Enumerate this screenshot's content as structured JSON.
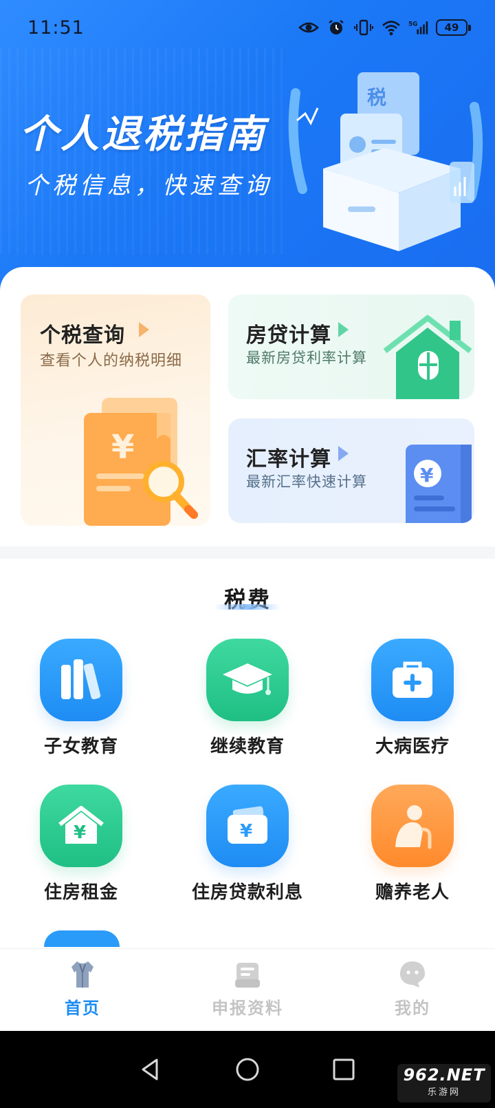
{
  "status_bar": {
    "time": "11:51",
    "battery": "49",
    "network": "5G"
  },
  "banner": {
    "title": "个人退税指南",
    "subtitle": "个税信息，快速查询",
    "illustration_label": "税"
  },
  "features": {
    "tax_query": {
      "title": "个税查询",
      "subtitle": "查看个人的纳税明细",
      "symbol": "¥"
    },
    "mortgage": {
      "title": "房贷计算",
      "subtitle": "最新房贷利率计算"
    },
    "exchange": {
      "title": "汇率计算",
      "subtitle": "最新汇率快速计算",
      "symbol": "¥"
    }
  },
  "section": {
    "title": "税费"
  },
  "categories": [
    {
      "label": "子女教育",
      "icon": "books-icon",
      "color": "blue"
    },
    {
      "label": "继续教育",
      "icon": "graduation-cap-icon",
      "color": "green"
    },
    {
      "label": "大病医疗",
      "icon": "medical-kit-icon",
      "color": "blue"
    },
    {
      "label": "住房租金",
      "icon": "house-yuan-icon",
      "color": "green"
    },
    {
      "label": "住房贷款利息",
      "icon": "wallet-yuan-icon",
      "color": "blue"
    },
    {
      "label": "赡养老人",
      "icon": "elderly-person-icon",
      "color": "orange"
    }
  ],
  "tabbar": {
    "tabs": [
      {
        "label": "首页",
        "icon": "shirt-icon",
        "active": true
      },
      {
        "label": "申报资料",
        "icon": "document-icon",
        "active": false
      },
      {
        "label": "我的",
        "icon": "chat-bubble-icon",
        "active": false
      }
    ]
  },
  "watermark": {
    "top": "962.NET",
    "bottom": "乐游网"
  },
  "colors": {
    "accent_blue": "#1a8cf5",
    "green": "#1fbf84",
    "orange": "#ff8a2b",
    "banner_blue": "#1b78f6"
  }
}
